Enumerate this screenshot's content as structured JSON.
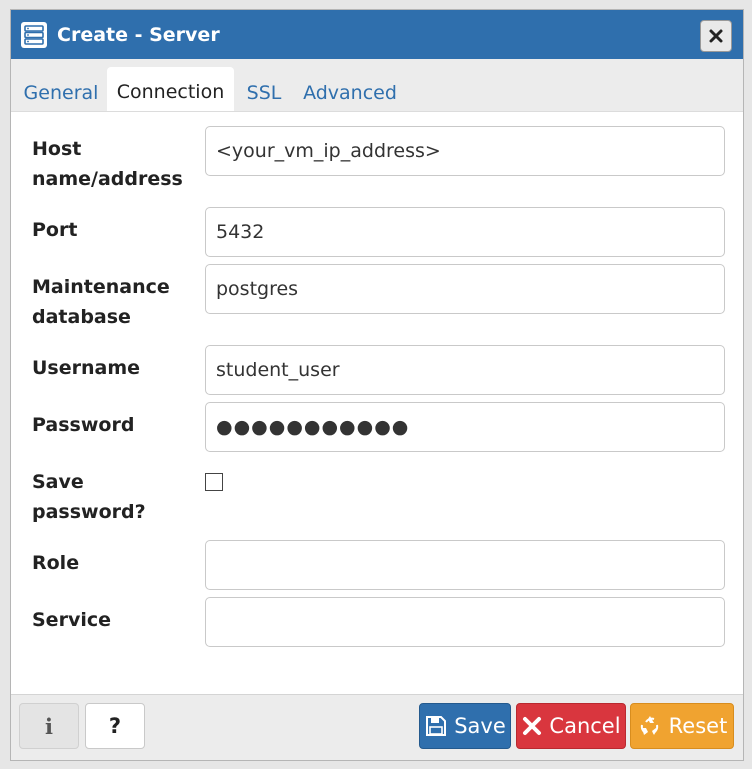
{
  "dialog": {
    "title": "Create - Server",
    "title_icon": "server-icon",
    "close_icon": "close-icon"
  },
  "tabs": [
    {
      "label": "General",
      "active": false
    },
    {
      "label": "Connection",
      "active": true
    },
    {
      "label": "SSL",
      "active": false
    },
    {
      "label": "Advanced",
      "active": false
    }
  ],
  "form": {
    "host": {
      "label_line1": "Host",
      "label_line2": "name/address",
      "value": "<your_vm_ip_address>"
    },
    "port": {
      "label": "Port",
      "value": "5432"
    },
    "maintenance_db": {
      "label_line1": "Maintenance",
      "label_line2": "database",
      "value": "postgres"
    },
    "username": {
      "label": "Username",
      "value": "student_user"
    },
    "password": {
      "label": "Password",
      "value": "●●●●●●●●●●●"
    },
    "save_password": {
      "label_line1": "Save",
      "label_line2": "password?",
      "checked": false
    },
    "role": {
      "label": "Role",
      "value": ""
    },
    "service": {
      "label": "Service",
      "value": ""
    }
  },
  "footer": {
    "info_label": "i",
    "help_label": "?",
    "save_label": "Save",
    "cancel_label": "Cancel",
    "reset_label": "Reset"
  },
  "colors": {
    "primary": "#2f6fad",
    "danger": "#d9363e",
    "warning": "#f0a330"
  }
}
